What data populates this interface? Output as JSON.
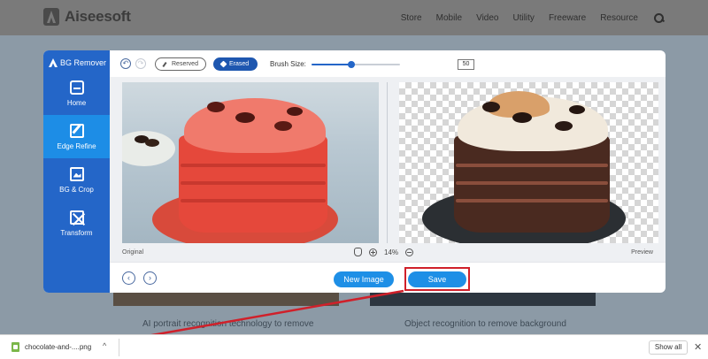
{
  "site": {
    "logo_text": "Aiseesoft",
    "nav": [
      "Store",
      "Mobile",
      "Video",
      "Utility",
      "Freeware",
      "Resource"
    ],
    "captions": [
      "AI portrait recognition technology to remove",
      "Object recognition to remove background"
    ]
  },
  "app": {
    "title": "BG Remover",
    "sidebar": [
      {
        "label": "Home",
        "icon": "home-icon"
      },
      {
        "label": "Edge Refine",
        "icon": "edge-refine-icon",
        "active": true
      },
      {
        "label": "BG & Crop",
        "icon": "crop-icon"
      },
      {
        "label": "Transform",
        "icon": "transform-icon"
      }
    ],
    "toolbar": {
      "reserved_label": "Reserved",
      "erased_label": "Erased",
      "brush_label": "Brush Size:",
      "brush_value": "50",
      "brush_level": 0.45
    },
    "bottom": {
      "original_label": "Original",
      "preview_label": "Preview",
      "zoom_level": "14%"
    },
    "footer": {
      "new_image_label": "New Image",
      "save_label": "Save"
    }
  },
  "download_bar": {
    "file_name": "chocolate-and-....png",
    "show_all_label": "Show all",
    "close_glyph": "✕",
    "chevron_glyph": "^"
  },
  "colors": {
    "sidebar": "#2466c8",
    "sidebar_active": "#1d8de6",
    "button_blue": "#1e8fe6",
    "highlight_red": "#d0202a"
  }
}
